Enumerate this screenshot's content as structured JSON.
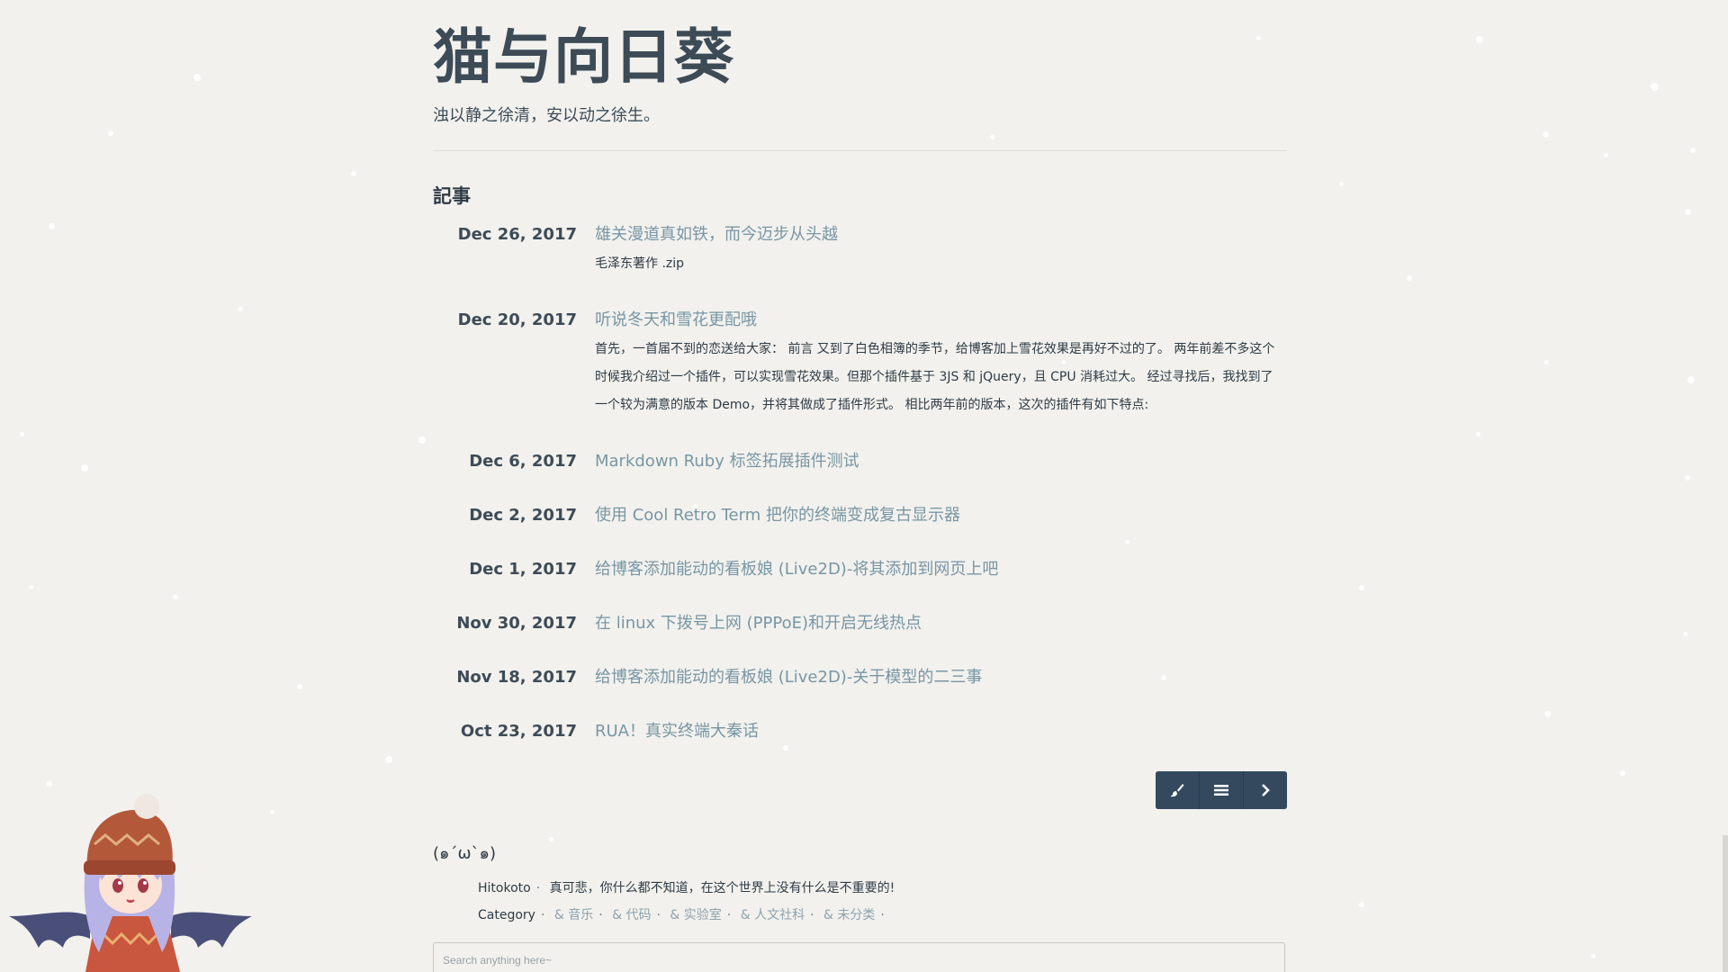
{
  "site": {
    "title": "猫与向日葵",
    "subtitle": "浊以静之徐清，安以动之徐生。"
  },
  "section": {
    "heading": "記事"
  },
  "posts": [
    {
      "date": "Dec 26, 2017",
      "title": "雄关漫道真如铁，而今迈步从头越",
      "excerpt": "毛泽东著作 .zip"
    },
    {
      "date": "Dec 20, 2017",
      "title": "听说冬天和雪花更配哦",
      "excerpt": "首先，一首届不到的恋送给大家： 前言 又到了白色相簿的季节，给博客加上雪花效果是再好不过的了。 两年前差不多这个时候我介绍过一个插件，可以实现雪花效果。但那个插件基于 3JS 和 jQuery，且 CPU 消耗过大。 经过寻找后，我找到了一个较为满意的版本 Demo，并将其做成了插件形式。 相比两年前的版本，这次的插件有如下特点:"
    },
    {
      "date": "Dec 6, 2017",
      "title": "Markdown Ruby 标签拓展插件测试",
      "excerpt": ""
    },
    {
      "date": "Dec 2, 2017",
      "title": "使用 Cool Retro Term 把你的终端变成复古显示器",
      "excerpt": ""
    },
    {
      "date": "Dec 1, 2017",
      "title": "给博客添加能动的看板娘 (Live2D)-将其添加到网页上吧",
      "excerpt": ""
    },
    {
      "date": "Nov 30, 2017",
      "title": "在 linux 下拨号上网 (PPPoE)和开启无线热点",
      "excerpt": ""
    },
    {
      "date": "Nov 18, 2017",
      "title": "给博客添加能动的看板娘 (Live2D)-关于模型的二三事",
      "excerpt": ""
    },
    {
      "date": "Oct 23, 2017",
      "title": "RUA！真实终端大秦话",
      "excerpt": ""
    }
  ],
  "pager": {
    "icons": [
      "brush-icon",
      "menu-icon",
      "chevron-right-icon"
    ]
  },
  "footer": {
    "face": "(๑´ω`๑)",
    "hitokoto_label": "Hitokoto",
    "hitokoto_text": "真可悲，你什么都不知道，在这个世界上没有什么是不重要的!",
    "category_label": "Category",
    "categories": [
      "& 音乐",
      "& 代码",
      "& 实验室",
      "& 人文社科",
      "& 未分类"
    ]
  },
  "search": {
    "placeholder": "Search anything here~"
  },
  "colors": {
    "background": "#f2f1ed",
    "text": "#34495e",
    "link": "#7896a4",
    "pager": "#34495e"
  }
}
